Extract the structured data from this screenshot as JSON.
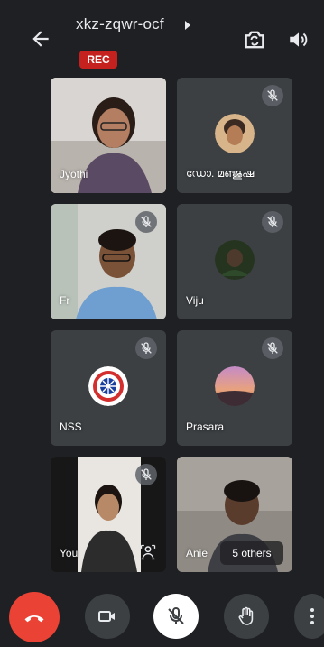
{
  "header": {
    "meeting_code": "xkz-zqwr-ocf",
    "rec_badge": "REC"
  },
  "participants": [
    {
      "name": "Jyothi",
      "muted": false
    },
    {
      "name": "ഡോ. മഞ്ജുഷ",
      "muted": true
    },
    {
      "name": "Fr",
      "muted": true
    },
    {
      "name": "Viju",
      "muted": true
    },
    {
      "name": "NSS",
      "muted": true
    },
    {
      "name": "Prasara",
      "muted": true
    },
    {
      "name": "You",
      "muted": true
    },
    {
      "name": "Anie",
      "muted": false
    }
  ],
  "others_label": "5 others",
  "controls": [
    "end-call",
    "camera",
    "microphone",
    "raise-hand",
    "more-options"
  ],
  "colors": {
    "background": "#1f2023",
    "tile": "#3c4043",
    "rec": "#c5221f",
    "end_call": "#ea4335"
  }
}
